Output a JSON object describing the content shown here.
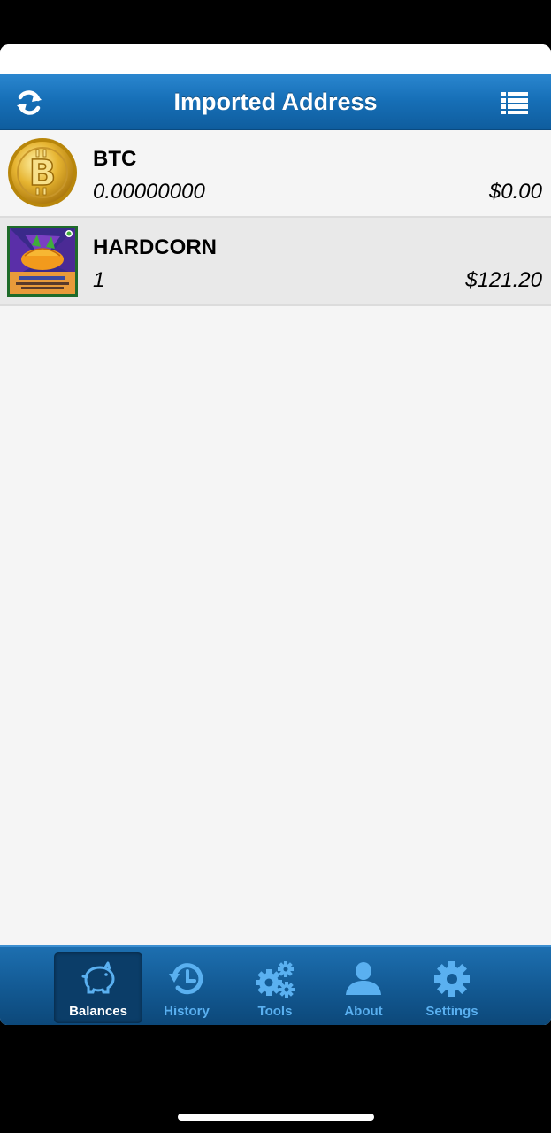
{
  "navbar": {
    "title": "Imported Address",
    "left_icon": "refresh-icon",
    "right_icon": "list-menu-icon",
    "color": "#1770b8"
  },
  "assets": [
    {
      "name": "BTC",
      "quantity": "0.00000000",
      "value": "$0.00",
      "icon": "bitcoin-coin-icon"
    },
    {
      "name": "HARDCORN",
      "quantity": "1",
      "value": "$121.20",
      "icon": "hardcorn-card-image"
    }
  ],
  "tabs": [
    {
      "label": "Balances",
      "icon": "piggy-bank-icon",
      "active": true
    },
    {
      "label": "History",
      "icon": "history-clock-icon",
      "active": false
    },
    {
      "label": "Tools",
      "icon": "gears-icon",
      "active": false
    },
    {
      "label": "About",
      "icon": "person-icon",
      "active": false
    },
    {
      "label": "Settings",
      "icon": "gear-icon",
      "active": false
    }
  ],
  "colors": {
    "tab_inactive": "#5ab0f0",
    "tab_active_bg": "#0b3d68",
    "list_bg": "#f5f5f5"
  }
}
